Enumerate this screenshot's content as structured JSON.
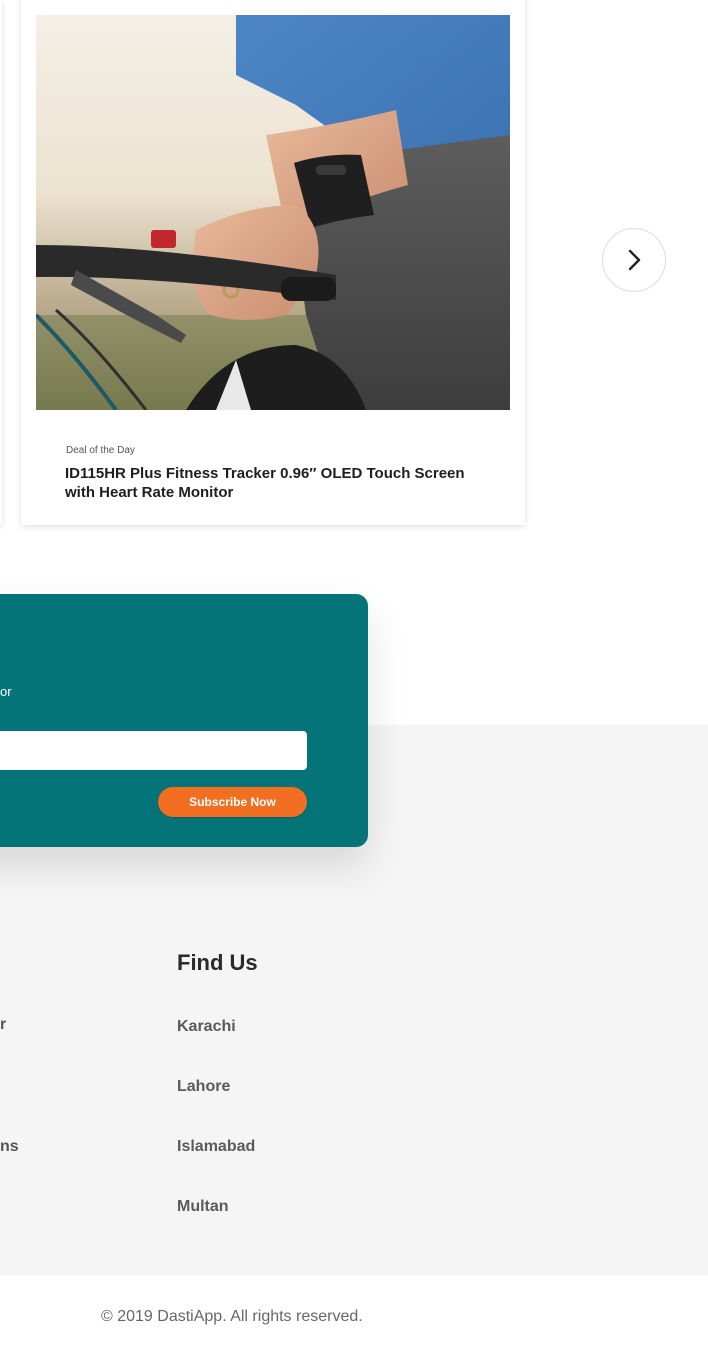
{
  "product": {
    "deal_label": "Deal of the Day",
    "title": "ID115HR Plus Fitness Tracker 0.96″ OLED Touch Screen with Heart Rate Monitor",
    "image_alt": "Man wearing fitness tracker while riding bicycle"
  },
  "carousel": {
    "next_icon": "chevron-right-icon"
  },
  "newsletter": {
    "text_fragment": "or",
    "input_value": "",
    "input_placeholder": "",
    "subscribe_label": "Subscribe Now",
    "bg_color": "#057479",
    "button_color": "#f26f21"
  },
  "footer": {
    "left_fragments": [
      "r",
      "ns"
    ],
    "find_us": {
      "heading": "Find Us",
      "cities": [
        "Karachi",
        "Lahore",
        "Islamabad",
        "Multan"
      ]
    },
    "copyright": "© 2019 DastiApp. All rights reserved."
  }
}
